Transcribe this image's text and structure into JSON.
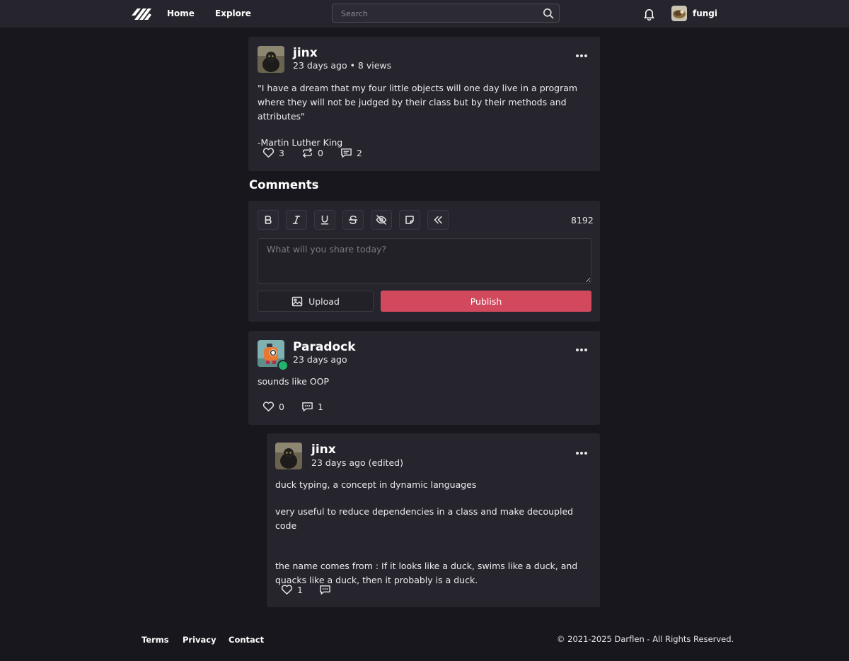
{
  "nav": {
    "home": "Home",
    "explore": "Explore",
    "search_placeholder": "Search",
    "username": "fungi"
  },
  "post": {
    "author": "jinx",
    "meta": "23 days ago • 8 views",
    "body": [
      "\"I have a dream that my four little objects will one day live in a program where they will not be judged by their class but by their methods and attributes\"",
      "-Martin Luther King"
    ],
    "likes": "3",
    "reposts": "0",
    "comments": "2"
  },
  "comments_heading": "Comments",
  "editor": {
    "char_count": "8192",
    "placeholder": "What will you share today?",
    "upload_label": "Upload",
    "publish_label": "Publish",
    "accent_color": "#d2495e"
  },
  "comment1": {
    "author": "Paradock",
    "meta": "23 days ago",
    "body": [
      "sounds like OOP"
    ],
    "likes": "0",
    "replies": "1"
  },
  "reply1": {
    "author": "jinx",
    "meta": "23 days ago (edited)",
    "body": [
      "duck typing, a concept in dynamic languages",
      "very useful to reduce dependencies in a class and make decoupled code",
      "the name comes from : If it looks like a duck, swims like a duck, and quacks like a duck, then it probably is a duck."
    ],
    "likes": "1"
  },
  "footer": {
    "terms": "Terms",
    "privacy": "Privacy",
    "contact": "Contact",
    "copyright": "© 2021-2025 Darflen - All Rights Reserved."
  }
}
